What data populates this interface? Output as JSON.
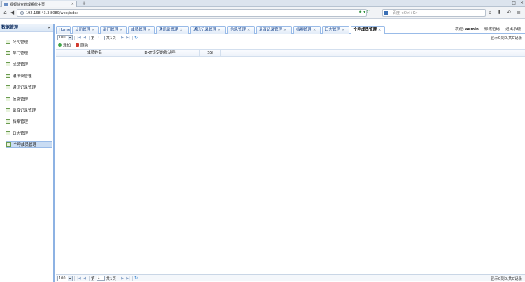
{
  "browser": {
    "tab_title": "视频综合管理系统主页",
    "url": "192.168.43.3:8080/web/index",
    "search_placeholder": "百度 <Ctrl+K>",
    "url_icons": "♦ ▾ C"
  },
  "sidebar": {
    "title": "数据管理",
    "collapse_label": "«",
    "items": [
      {
        "label": "公司管理"
      },
      {
        "label": "部门管理"
      },
      {
        "label": "成员管理"
      },
      {
        "label": "通讯录管理"
      },
      {
        "label": "通讯记录管理"
      },
      {
        "label": "信息管理"
      },
      {
        "label": "录音记录管理"
      },
      {
        "label": "档案管理"
      },
      {
        "label": "日志管理"
      },
      {
        "label": "个呼成员管理"
      }
    ]
  },
  "tabs": [
    {
      "label": "Home",
      "closable": false
    },
    {
      "label": "公司管理",
      "closable": true
    },
    {
      "label": "部门管理",
      "closable": true
    },
    {
      "label": "成员管理",
      "closable": true
    },
    {
      "label": "通讯录管理",
      "closable": true
    },
    {
      "label": "通讯记录管理",
      "closable": true
    },
    {
      "label": "信息管理",
      "closable": true
    },
    {
      "label": "录音记录管理",
      "closable": true
    },
    {
      "label": "档案管理",
      "closable": true
    },
    {
      "label": "日志管理",
      "closable": true
    },
    {
      "label": "个呼成员管理",
      "closable": true
    }
  ],
  "user": {
    "welcome": "欢迎:",
    "name": "admin",
    "change_password": "修改密码",
    "logout": "退出系统"
  },
  "pager_top": {
    "page_size": "100",
    "page_label": "第",
    "page_value": "1",
    "total_pages": "共1页",
    "info": "显示0到0,共0记录"
  },
  "toolbar": {
    "add": "添加",
    "delete": "删除"
  },
  "grid": {
    "columns": [
      "成员姓名",
      "DXT设定的默认呼",
      "SSI"
    ]
  },
  "pager_bottom": {
    "page_size": "100",
    "page_label": "第",
    "page_value": "1",
    "total_pages": "共1页",
    "info": "显示0到0,共0记录"
  }
}
